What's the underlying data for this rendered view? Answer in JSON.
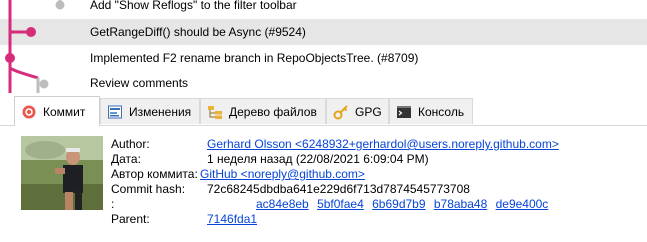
{
  "commits": [
    {
      "message": "Add \"Show Reflogs\" to the filter toolbar"
    },
    {
      "message": "GetRangeDiff() should be Async (#9524)"
    },
    {
      "message": "Implemented F2 rename branch in RepoObjectsTree. (#8709)"
    },
    {
      "message": "Review comments"
    }
  ],
  "selected_index": 1,
  "graph_color": "#d62d7a",
  "tabs": [
    {
      "label": "Коммит",
      "icon": "commit-icon"
    },
    {
      "label": "Изменения",
      "icon": "diff-icon"
    },
    {
      "label": "Дерево файлов",
      "icon": "file-tree-icon"
    },
    {
      "label": "GPG",
      "icon": "key-icon"
    },
    {
      "label": "Консоль",
      "icon": "console-icon"
    }
  ],
  "active_tab": 0,
  "details": {
    "author_label": "Author:",
    "author_value": "Gerhard Olsson <6248932+gerhardol@users.noreply.github.com>",
    "date_label": "Дата:",
    "date_value": "1 неделя назад (22/08/2021 6:09:04 PM)",
    "committer_label": "Автор коммита:",
    "committer_value": "GitHub <noreply@github.com>",
    "hash_label": "Commit hash:",
    "hash_value": "72c68245dbdba641e229d6f713d7874545773708",
    "children_label": ":",
    "children": [
      "ac84e8eb",
      "5bf0fae4",
      "6b69d7b9",
      "b78aba48",
      "de9e400c"
    ],
    "parent_label": "Parent:",
    "parent_value": "7146fda1"
  }
}
